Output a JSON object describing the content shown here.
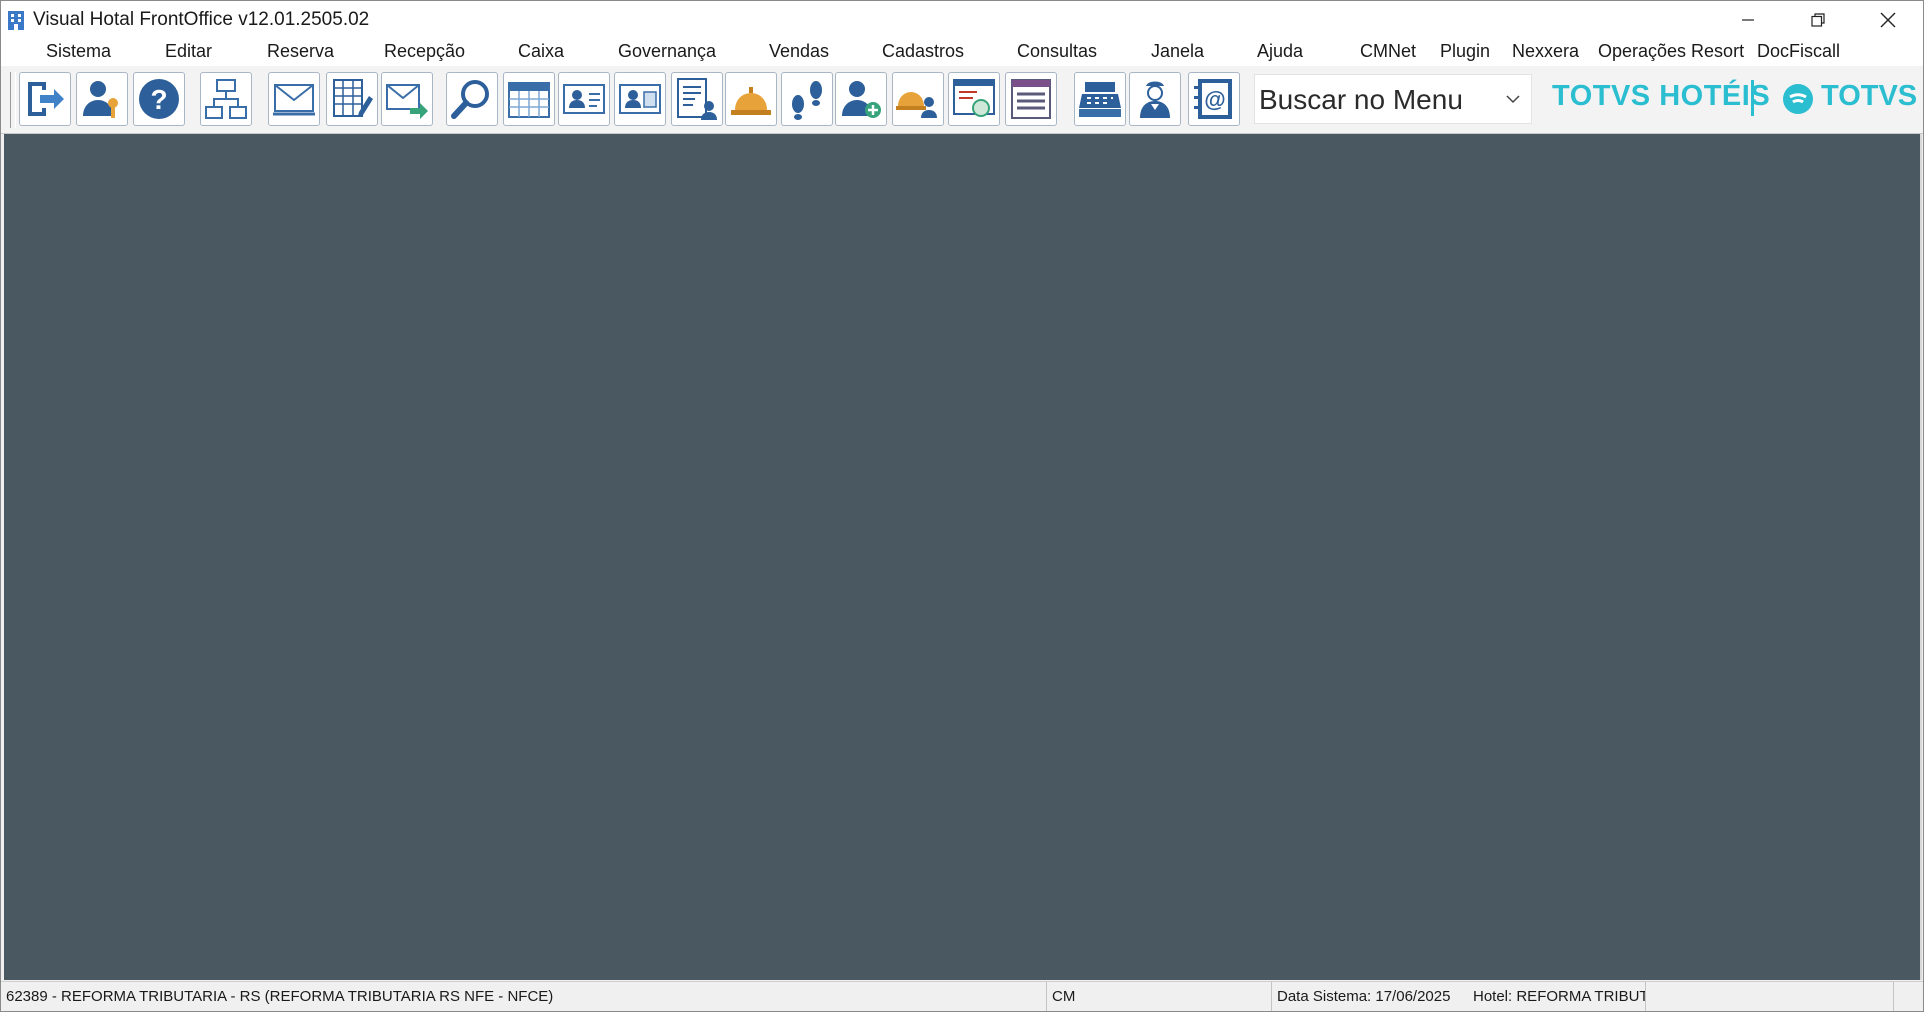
{
  "window": {
    "title": "Visual Hotal FrontOffice v12.01.2505.02",
    "app_icon": "hotel-building-icon",
    "controls": [
      "minimize-icon",
      "restore-icon",
      "close-icon"
    ]
  },
  "menu": {
    "items": [
      {
        "id": "sistema",
        "label": "Sistema"
      },
      {
        "id": "editar",
        "label": "Editar"
      },
      {
        "id": "reserva",
        "label": "Reserva"
      },
      {
        "id": "recepcao",
        "label": "Recepção"
      },
      {
        "id": "caixa",
        "label": "Caixa"
      },
      {
        "id": "governanca",
        "label": "Governança"
      },
      {
        "id": "vendas",
        "label": "Vendas"
      },
      {
        "id": "cadastros",
        "label": "Cadastros"
      },
      {
        "id": "consultas",
        "label": "Consultas"
      },
      {
        "id": "janela",
        "label": "Janela"
      },
      {
        "id": "ajuda",
        "label": "Ajuda"
      },
      {
        "id": "cmnet",
        "label": "CMNet"
      },
      {
        "id": "plugin",
        "label": "Plugin"
      },
      {
        "id": "nexxera",
        "label": "Nexxera"
      },
      {
        "id": "operacoes-resort",
        "label": "Operações Resort"
      },
      {
        "id": "docfiscall",
        "label": "DocFiscall"
      }
    ]
  },
  "toolbar": {
    "buttons": [
      "exit-icon",
      "user-key-icon",
      "help-icon",
      "network-icon",
      "mail-inbox-icon",
      "spreadsheet-edit-icon",
      "mail-send-icon",
      "search-icon",
      "calendar-icon",
      "guest-card-icon",
      "guest-card-alt-icon",
      "guest-list-icon",
      "service-bell-icon",
      "footprints-icon",
      "add-user-icon",
      "bell-user-icon",
      "invoice-icon",
      "list-icon",
      "cash-register-icon",
      "maid-icon",
      "address-book-icon"
    ],
    "search": {
      "value": "Buscar no Menu"
    },
    "brand": {
      "primary": "TOTVS HOTÉIS",
      "secondary": "TOTVS",
      "color": "#2bbdd0"
    }
  },
  "workspace": {
    "background": "#4a5961"
  },
  "statusbar": {
    "hotel_info": "62389 - REFORMA TRIBUTARIA - RS (REFORMA TRIBUTARIA RS NFE - NFCE)",
    "mode": "CM",
    "system_date": "Data Sistema: 17/06/2025",
    "hotel_name": "Hotel: REFORMA TRIBUT"
  }
}
